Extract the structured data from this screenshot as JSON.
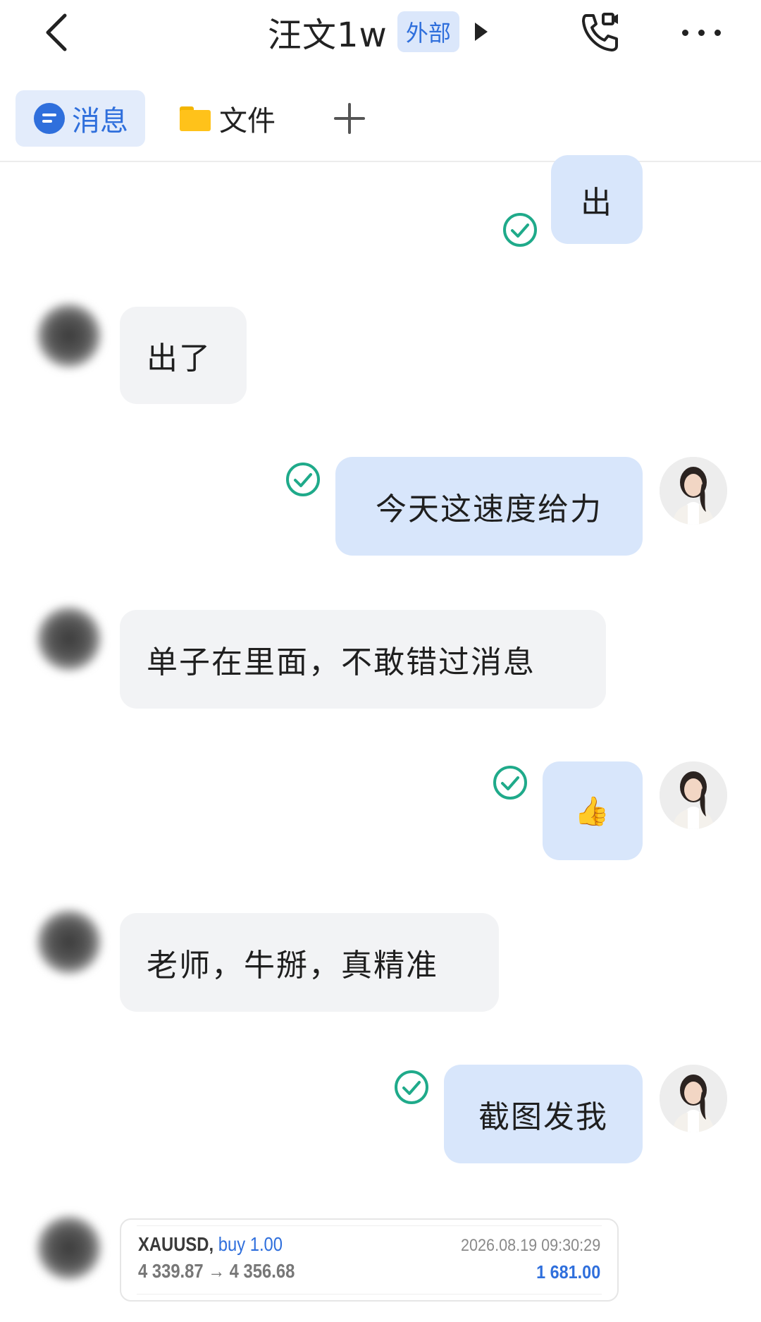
{
  "header": {
    "title": "汪文1w",
    "badge": "外部"
  },
  "tabs": {
    "messages_label": "消息",
    "files_label": "文件"
  },
  "messages": [
    {
      "direction": "out",
      "text": "出",
      "status": "read"
    },
    {
      "direction": "in",
      "text": "出了"
    },
    {
      "direction": "out",
      "text": "今天这速度给力",
      "status": "read"
    },
    {
      "direction": "in",
      "text": "单子在里面，不敢错过消息"
    },
    {
      "direction": "out",
      "text": "👍",
      "status": "read"
    },
    {
      "direction": "in",
      "text": "老师，牛掰，真精准"
    },
    {
      "direction": "out",
      "text": "截图发我",
      "status": "read"
    }
  ],
  "trade_card": {
    "symbol": "XAUUSD,",
    "side": "buy 1.00",
    "prices": "4 339.87 → 4 356.68",
    "time": "2026.08.19 09:30:29",
    "profit": "1 681.00"
  },
  "colors": {
    "accent": "#2f6fdc",
    "out_bubble": "#d8e6fb",
    "in_bubble": "#f2f3f5",
    "check": "#1faa8a"
  }
}
